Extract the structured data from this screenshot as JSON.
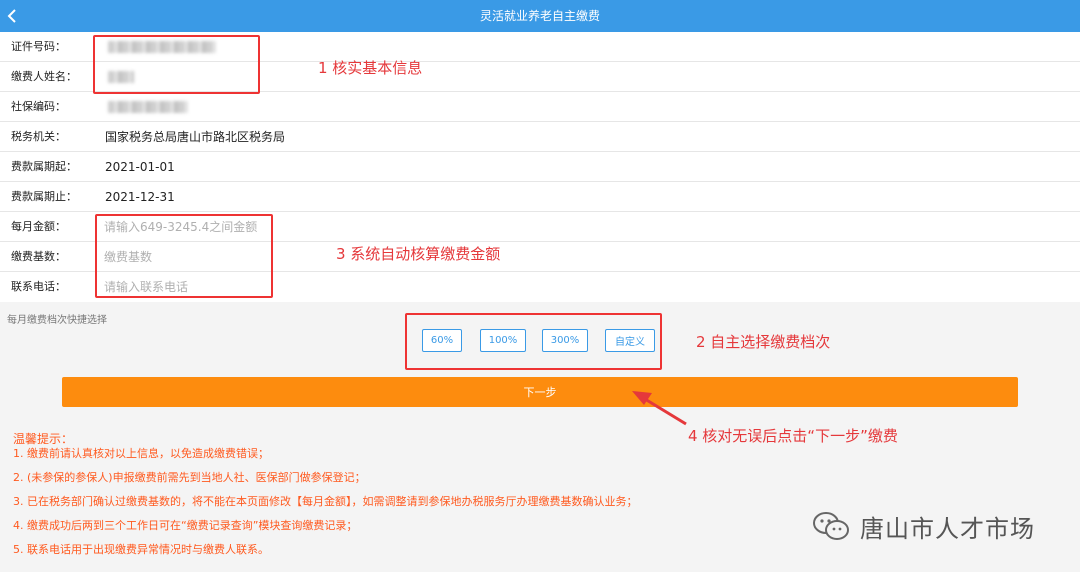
{
  "header": {
    "title": "灵活就业养老自主缴费",
    "back_icon": "chevron-left-icon"
  },
  "form": {
    "rows": [
      {
        "label": "证件号码：",
        "value": ""
      },
      {
        "label": "缴费人姓名：",
        "value": ""
      },
      {
        "label": "社保编码：",
        "value": ""
      },
      {
        "label": "税务机关：",
        "value": "国家税务总局唐山市路北区税务局"
      },
      {
        "label": "费款属期起：",
        "value": "2021-01-01"
      },
      {
        "label": "费款属期止：",
        "value": "2021-12-31"
      }
    ],
    "monthly_amount": {
      "label": "每月金额：",
      "placeholder": "请输入649-3245.4之间金额"
    },
    "base": {
      "label": "缴费基数：",
      "placeholder": "缴费基数"
    },
    "phone": {
      "label": "联系电话：",
      "placeholder": "请输入联系电话"
    }
  },
  "quick_select": {
    "label": "每月缴费档次快捷选择",
    "options": [
      "60%",
      "100%",
      "300%",
      "自定义"
    ]
  },
  "next_button": "下一步",
  "annotations": {
    "a1": "1 核实基本信息",
    "a2": "2 自主选择缴费档次",
    "a3": "3 系统自动核算缴费金额",
    "a4": "4 核对无误后点击“下一步”缴费"
  },
  "tips": {
    "title": "温馨提示：",
    "items": [
      "1. 缴费前请认真核对以上信息，以免造成缴费错误；",
      "2. (未参保的参保人)申报缴费前需先到当地人社、医保部门做参保登记；",
      "3. 已在税务部门确认过缴费基数的，将不能在本页面修改【每月金额】，如需调整请到参保地办税服务厅办理缴费基数确认业务；",
      "4. 缴费成功后两到三个工作日可在“缴费记录查询”模块查询缴费记录；",
      "5. 联系电话用于出现缴费异常情况时与缴费人联系。"
    ]
  },
  "watermark": {
    "text": "唐山市人才市场",
    "icon": "wechat-icon"
  },
  "colors": {
    "header": "#3a9ae6",
    "next_button": "#fd8c0e",
    "annotation": "#e5383b",
    "tips": "#ff5a1f"
  }
}
